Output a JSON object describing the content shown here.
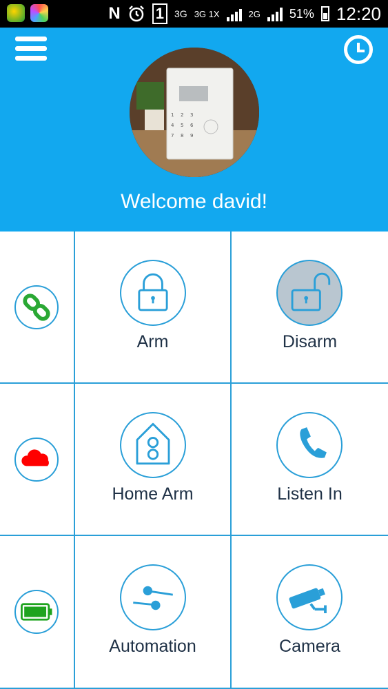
{
  "status_bar": {
    "carrier_indicator": "N",
    "sim_slot": "1",
    "network_1": "3G",
    "network_2": "3G 1X",
    "network_3": "2G",
    "battery_percent": "51%",
    "time": "12:20"
  },
  "header": {
    "menu_icon": "hamburger-menu-icon",
    "history_icon": "clock-icon",
    "welcome_text": "Welcome david!",
    "background_color": "#12a8ef"
  },
  "status_icons": [
    {
      "name": "link-status-icon",
      "color": "#2aa834"
    },
    {
      "name": "cloud-status-icon",
      "color": "#ff0000"
    },
    {
      "name": "battery-status-icon",
      "color": "#1ea31e"
    }
  ],
  "actions": {
    "arm": {
      "label": "Arm",
      "icon": "lock-closed-icon"
    },
    "disarm": {
      "label": "Disarm",
      "icon": "lock-open-icon",
      "active": true
    },
    "home_arm": {
      "label": "Home Arm",
      "icon": "home-icon"
    },
    "listen_in": {
      "label": "Listen In",
      "icon": "phone-icon"
    },
    "automation": {
      "label": "Automation",
      "icon": "switch-icon"
    },
    "camera": {
      "label": "Camera",
      "icon": "cctv-camera-icon"
    }
  },
  "accent_color": "#2a9fd8"
}
